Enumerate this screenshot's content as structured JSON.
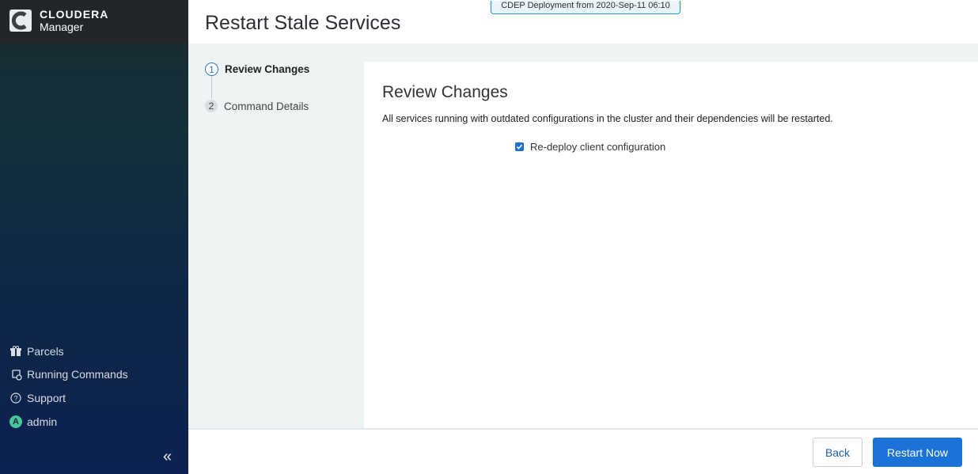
{
  "brand": {
    "title": "CLOUDERA",
    "subtitle": "Manager"
  },
  "sidebar": {
    "items": [
      {
        "label": "Parcels",
        "icon": "gift-icon"
      },
      {
        "label": "Running Commands",
        "icon": "commands-icon"
      },
      {
        "label": "Support",
        "icon": "help-icon"
      },
      {
        "label": "admin",
        "icon": "avatar",
        "avatar_letter": "A"
      }
    ],
    "collapse_glyph": "«"
  },
  "header": {
    "title": "Restart Stale Services",
    "deployment_badge": "CDEP Deployment from 2020-Sep-11 06:10"
  },
  "wizard": {
    "steps": [
      {
        "number": "1",
        "label": "Review Changes",
        "state": "active"
      },
      {
        "number": "2",
        "label": "Command Details",
        "state": "inactive"
      }
    ]
  },
  "content": {
    "title": "Review Changes",
    "description": "All services running with outdated configurations in the cluster and their dependencies will be restarted.",
    "checkbox_label": "Re-deploy client configuration",
    "checkbox_checked": true
  },
  "footer": {
    "back_label": "Back",
    "restart_label": "Restart Now"
  },
  "colors": {
    "primary": "#1b73d8",
    "sidebar_top": "#1b2a30",
    "sidebar_bottom": "#0c2150",
    "avatar": "#47c79b"
  }
}
